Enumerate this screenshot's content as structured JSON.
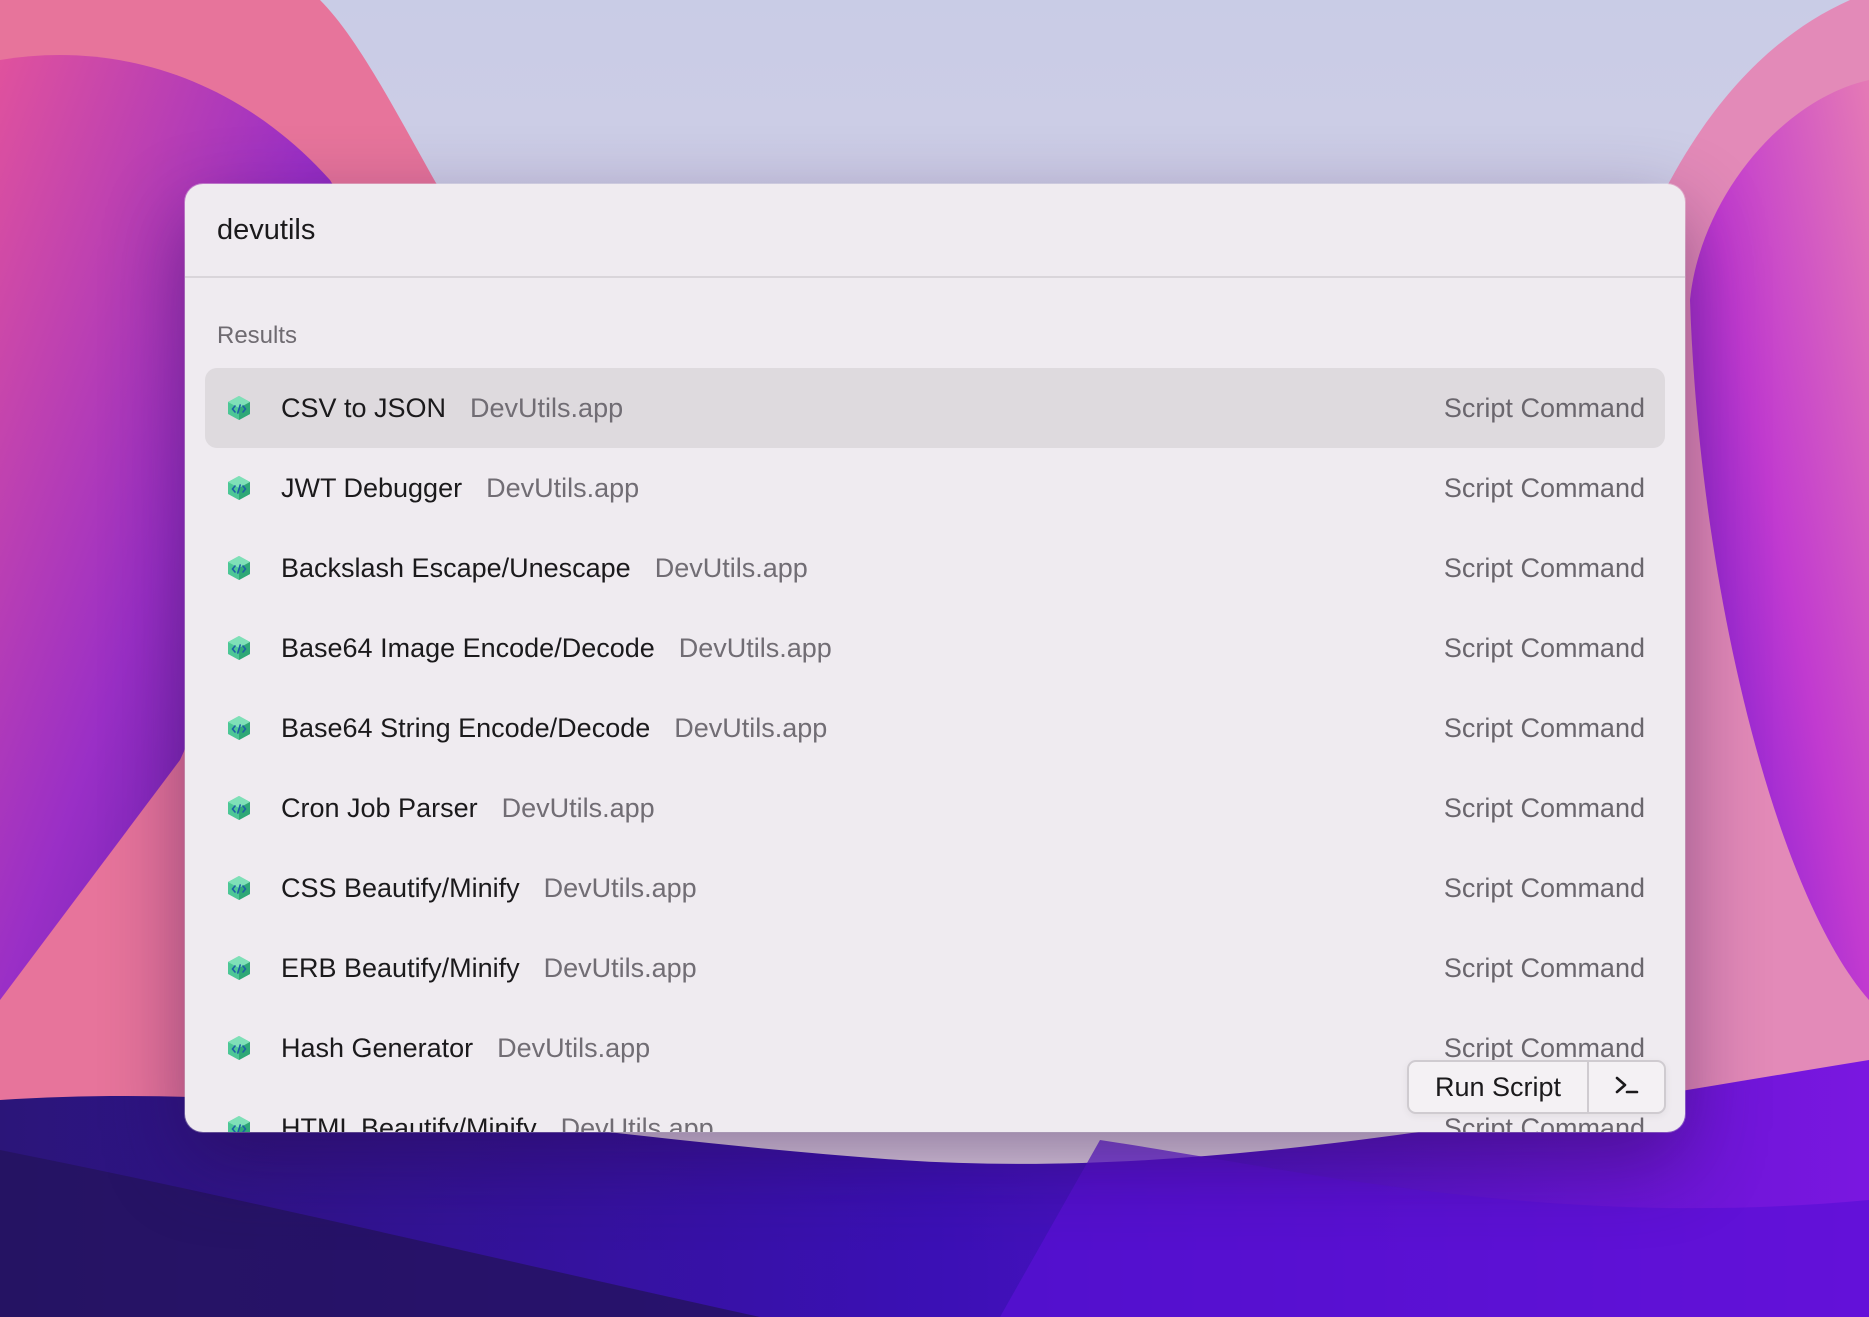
{
  "search": {
    "query": "devutils"
  },
  "results": {
    "section_title": "Results",
    "items": [
      {
        "title": "CSV to JSON",
        "subtitle": "DevUtils.app",
        "type": "Script Command",
        "icon": "devutils-icon",
        "selected": true
      },
      {
        "title": "JWT Debugger",
        "subtitle": "DevUtils.app",
        "type": "Script Command",
        "icon": "devutils-icon"
      },
      {
        "title": "Backslash Escape/Unescape",
        "subtitle": "DevUtils.app",
        "type": "Script Command",
        "icon": "devutils-icon"
      },
      {
        "title": "Base64 Image Encode/Decode",
        "subtitle": "DevUtils.app",
        "type": "Script Command",
        "icon": "devutils-icon"
      },
      {
        "title": "Base64 String Encode/Decode",
        "subtitle": "DevUtils.app",
        "type": "Script Command",
        "icon": "devutils-icon"
      },
      {
        "title": "Cron Job Parser",
        "subtitle": "DevUtils.app",
        "type": "Script Command",
        "icon": "devutils-icon"
      },
      {
        "title": "CSS Beautify/Minify",
        "subtitle": "DevUtils.app",
        "type": "Script Command",
        "icon": "devutils-icon"
      },
      {
        "title": "ERB Beautify/Minify",
        "subtitle": "DevUtils.app",
        "type": "Script Command",
        "icon": "devutils-icon"
      },
      {
        "title": "Hash Generator",
        "subtitle": "DevUtils.app",
        "type": "Script Command",
        "icon": "devutils-icon"
      },
      {
        "title": "HTML Beautify/Minify",
        "subtitle": "DevUtils.app",
        "type": "Script Command",
        "icon": "devutils-icon"
      }
    ]
  },
  "action_panel": {
    "primary_label": "Run Script",
    "secondary_icon": "terminal-icon"
  },
  "colors": {
    "panel_bg": "#efebf0",
    "selected_row_bg": "#dedade",
    "icon_green": "#3fbf8a"
  }
}
